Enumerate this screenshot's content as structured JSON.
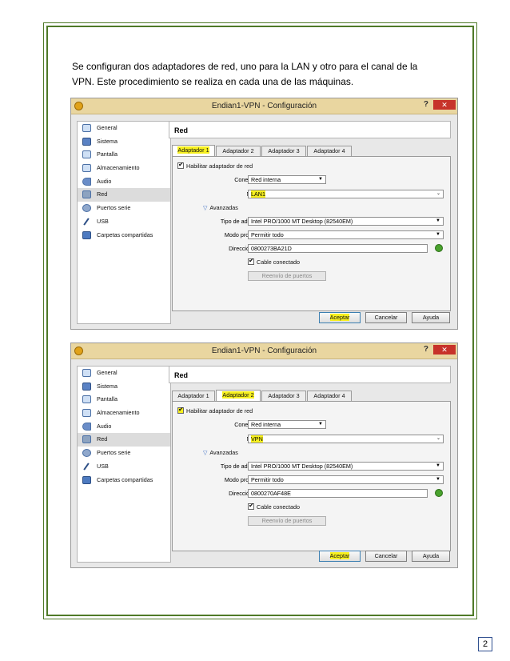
{
  "intro": {
    "line1": "Se configuran dos adaptadores de red, uno para la LAN y otro para el canal de la",
    "line2": "VPN.  Este procedimiento se realiza en cada una de las máquinas."
  },
  "dialogs": [
    {
      "title": "Endian1-VPN - Configuración",
      "help": "?",
      "close": "✕",
      "sidebar": [
        "General",
        "Sistema",
        "Pantalla",
        "Almacenamiento",
        "Audio",
        "Red",
        "Puertos serie",
        "USB",
        "Carpetas compartidas"
      ],
      "section_title": "Red",
      "tabs": [
        "Adaptador 1",
        "Adaptador 2",
        "Adaptador 3",
        "Adaptador 4"
      ],
      "enable_label": "Habilitar adaptador de red",
      "attached_label": "Conectado a:",
      "attached_value": "Red interna",
      "name_label": "Nombre:",
      "name_value": "LAN1",
      "advanced_label": "Avanzadas",
      "adapter_type_label": "Tipo de adaptador:",
      "adapter_type_value": "Intel PRO/1000 MT Desktop (82540EM)",
      "promisc_label": "Modo promiscuo:",
      "promisc_value": "Permitir todo",
      "mac_label": "Dirección MAC:",
      "mac_value": "0800273BA21D",
      "cable_label": "Cable conectado",
      "port_forward_label": "Reenvío de puertos",
      "ok_label": "Aceptar",
      "cancel_label": "Cancelar",
      "help_label": "Ayuda"
    },
    {
      "title": "Endian1-VPN - Configuración",
      "help": "?",
      "close": "✕",
      "sidebar": [
        "General",
        "Sistema",
        "Pantalla",
        "Almacenamiento",
        "Audio",
        "Red",
        "Puertos serie",
        "USB",
        "Carpetas compartidas"
      ],
      "section_title": "Red",
      "tabs": [
        "Adaptador 1",
        "Adaptador 2",
        "Adaptador 3",
        "Adaptador 4"
      ],
      "enable_label": "Habilitar adaptador de red",
      "attached_label": "Conectado a:",
      "attached_value": "Red interna",
      "name_label": "Nombre:",
      "name_value": "VPN",
      "advanced_label": "Avanzadas",
      "adapter_type_label": "Tipo de adaptador:",
      "adapter_type_value": "Intel PRO/1000 MT Desktop (82540EM)",
      "promisc_label": "Modo promiscuo:",
      "promisc_value": "Permitir todo",
      "mac_label": "Dirección MAC:",
      "mac_value": "0800270AF48E",
      "cable_label": "Cable conectado",
      "port_forward_label": "Reenvío de puertos",
      "ok_label": "Aceptar",
      "cancel_label": "Cancelar",
      "help_label": "Ayuda"
    }
  ],
  "page_number": "2",
  "colors": {
    "border": "#4f7a28",
    "highlight": "#f7f01f",
    "titlebar": "#e9d6a0"
  }
}
